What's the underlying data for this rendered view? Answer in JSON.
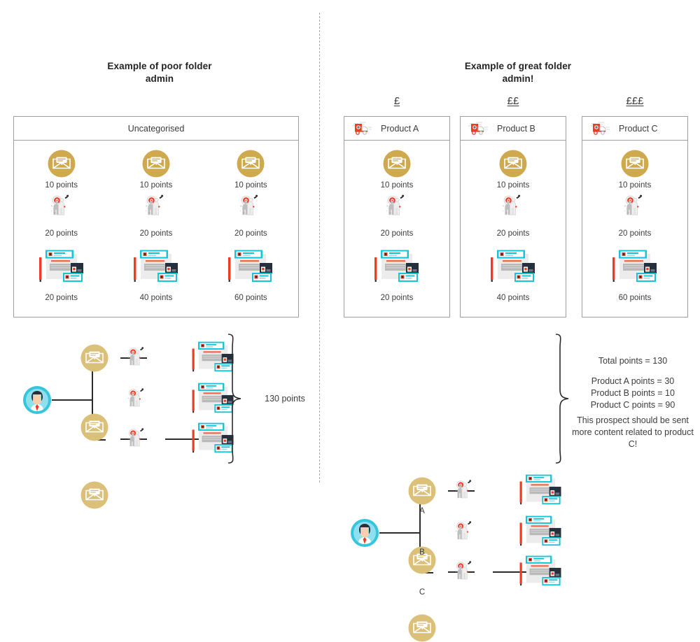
{
  "meta": {
    "colors": {
      "gold": "#cfa94e",
      "gold_light": "#dbc07a",
      "cyan": "#35c6dd",
      "teal": "#17c3d6",
      "red": "#ef3a24",
      "grey_line": "#9e9e9e",
      "text": "#3c3c3c",
      "dark_line": "#2b2b2b"
    }
  },
  "left": {
    "title": "Example of poor folder\nadmin",
    "title_line1": "Example of poor folder",
    "title_line2": "admin",
    "folder": {
      "name": "Uncategorised",
      "columns": [
        {
          "items": [
            {
              "icon": "email-icon",
              "points": "10 points"
            },
            {
              "icon": "target-people-icon",
              "points": "20 points"
            },
            {
              "icon": "landing-page-icon",
              "points": "20 points"
            }
          ]
        },
        {
          "items": [
            {
              "icon": "email-icon",
              "points": "10 points"
            },
            {
              "icon": "target-people-icon",
              "points": "20 points"
            },
            {
              "icon": "landing-page-icon",
              "points": "40 points"
            }
          ]
        },
        {
          "items": [
            {
              "icon": "email-icon",
              "points": "10 points"
            },
            {
              "icon": "target-people-icon",
              "points": "20 points"
            },
            {
              "icon": "landing-page-icon",
              "points": "60 points"
            }
          ]
        }
      ]
    },
    "tree": {
      "rows": [
        {
          "label": "",
          "nodes": [
            "email-icon",
            "target-people-icon",
            "landing-page-icon"
          ]
        },
        {
          "label": "",
          "nodes": [
            "email-icon",
            "target-people-icon",
            "landing-page-icon"
          ]
        },
        {
          "label": "",
          "nodes": [
            "email-icon",
            "target-people-icon",
            "landing-page-icon"
          ]
        }
      ],
      "total_label": "130 points"
    }
  },
  "right": {
    "title_line1": "Example of great folder",
    "title_line2": "admin!",
    "folders": [
      {
        "currency": "£",
        "name": "Product A",
        "icon": "delivery-truck-icon",
        "items": [
          {
            "icon": "email-icon",
            "points": "10 points"
          },
          {
            "icon": "target-people-icon",
            "points": "20 points"
          },
          {
            "icon": "landing-page-icon",
            "points": "20 points"
          }
        ]
      },
      {
        "currency": "££",
        "name": "Product B",
        "icon": "delivery-truck-icon",
        "items": [
          {
            "icon": "email-icon",
            "points": "10 points"
          },
          {
            "icon": "target-people-icon",
            "points": "20 points"
          },
          {
            "icon": "landing-page-icon",
            "points": "40 points"
          }
        ]
      },
      {
        "currency": "£££",
        "name": "Product C",
        "icon": "delivery-truck-icon",
        "items": [
          {
            "icon": "email-icon",
            "points": "10 points"
          },
          {
            "icon": "target-people-icon",
            "points": "20 points"
          },
          {
            "icon": "landing-page-icon",
            "points": "60 points"
          }
        ]
      }
    ],
    "tree": {
      "row_labels": [
        "A",
        "B",
        "C"
      ]
    },
    "summary": {
      "total": "Total points = 130",
      "product_a": "Product A points = 30",
      "product_b": "Product B points = 10",
      "product_c": "Product C points = 90",
      "advice_line1": "This prospect should be sent",
      "advice_line2": "more content related to product",
      "advice_line3": "C!"
    }
  }
}
